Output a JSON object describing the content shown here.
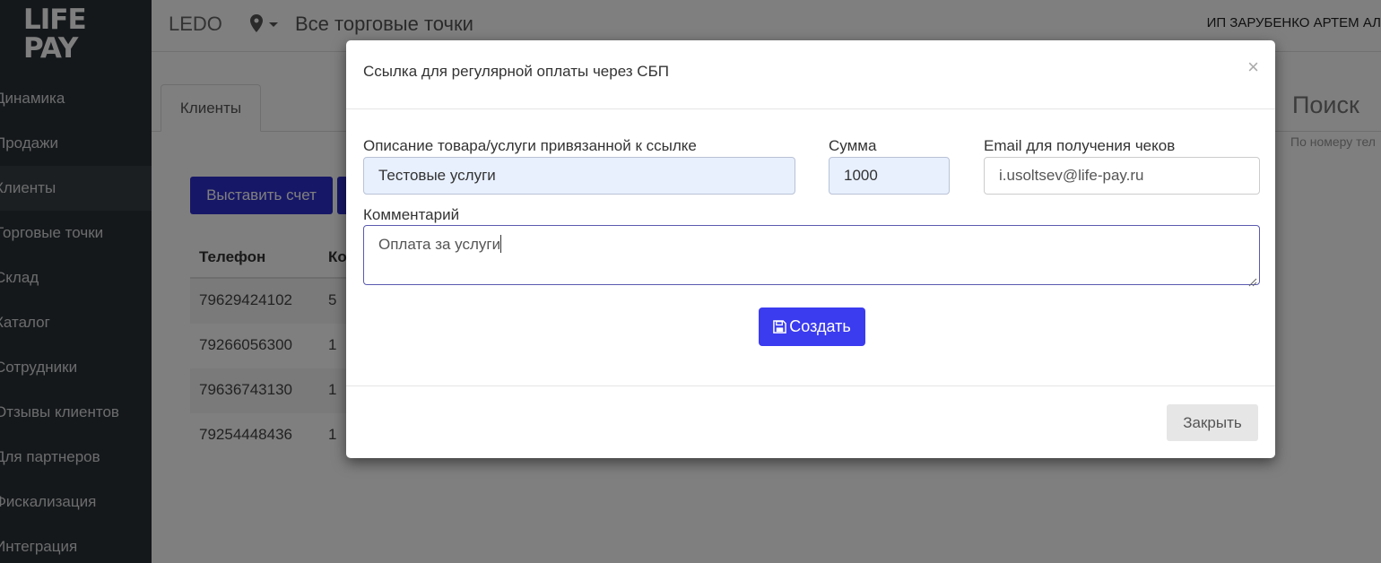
{
  "app": {
    "logo_line1": "LIFE",
    "logo_line2": "PAY",
    "brand": "LEDO",
    "store_selector": "Все торговые точки",
    "user_name": "ИП ЗАРУБЕНКО АРТЕМ АЛ"
  },
  "sidebar": {
    "items": [
      {
        "label": "Динамика"
      },
      {
        "label": "Продажи"
      },
      {
        "label": "Клиенты"
      },
      {
        "label": "Торговые точки"
      },
      {
        "label": "Склад"
      },
      {
        "label": "Каталог"
      },
      {
        "label": "Сотрудники"
      },
      {
        "label": "Отзывы клиентов"
      },
      {
        "label": "Для партнеров"
      },
      {
        "label": "Фискализация"
      },
      {
        "label": "Интеграция"
      }
    ]
  },
  "main": {
    "tab_label": "Клиенты",
    "invoice_button": "Выставить счет",
    "search_title": "Поиск",
    "search_hint": "По номеру тел",
    "table": {
      "headers": [
        "Телефон",
        "Ко"
      ],
      "rows": [
        {
          "phone": "79629424102",
          "count": "5"
        },
        {
          "phone": "79266056300",
          "count": "1"
        },
        {
          "phone": "79636743130",
          "count": "1"
        },
        {
          "phone": "79254448436",
          "count": "1"
        }
      ]
    }
  },
  "modal": {
    "title": "Ссылка для регулярной оплаты через СБП",
    "close_symbol": "×",
    "description_label": "Описание товара/услуги привязанной к ссылке",
    "description_value": "Тестовые услуги",
    "amount_label": "Сумма",
    "amount_value": "1000",
    "email_label": "Email для получения чеков",
    "email_value": "i.usoltsev@life-pay.ru",
    "comment_label": "Комментарий",
    "comment_value": "Оплата за услуги",
    "create_button": "Создать",
    "close_button": "Закрыть"
  },
  "colors": {
    "sidebar_bg": "#2b3036",
    "primary_button": "#2f2fcf",
    "create_button": "#3b3bf0",
    "autofill_bg": "#e8f0fe"
  },
  "icons": {
    "location": "map-pin-icon",
    "dropdown": "caret-down-icon",
    "save": "floppy-disk-icon",
    "close": "close-icon"
  }
}
